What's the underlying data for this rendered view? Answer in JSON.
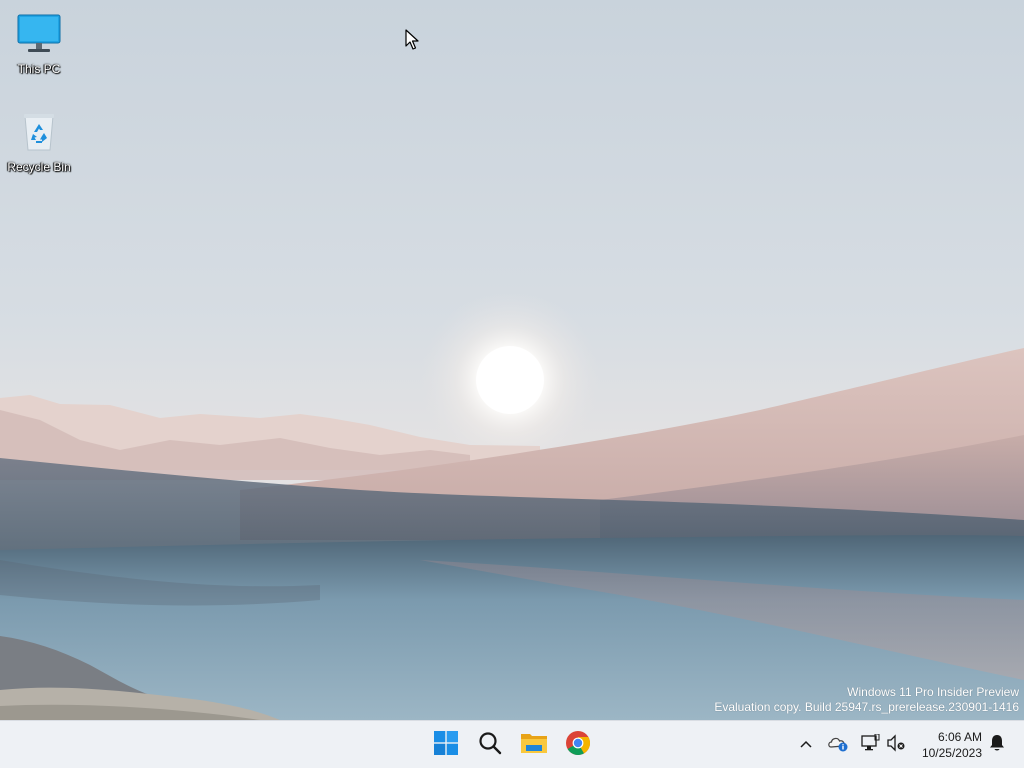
{
  "desktop": {
    "icons": [
      {
        "label": "This PC",
        "icon": "monitor-icon"
      },
      {
        "label": "Recycle Bin",
        "icon": "recycle-bin-icon"
      }
    ],
    "watermark": {
      "line1": "Windows 11 Pro Insider Preview",
      "line2": "Evaluation copy. Build 25947.rs_prerelease.230901-1416"
    }
  },
  "taskbar": {
    "pinned": [
      {
        "name": "Start",
        "icon": "windows-logo-icon"
      },
      {
        "name": "Search",
        "icon": "search-icon"
      },
      {
        "name": "File Explorer",
        "icon": "folder-icon"
      },
      {
        "name": "Google Chrome",
        "icon": "chrome-icon"
      }
    ],
    "tray": {
      "icons": [
        "chevron-up-icon",
        "onedrive-icon",
        "network-icon",
        "volume-muted-icon",
        "notification-bell-icon"
      ],
      "time": "6:06 AM",
      "date": "10/25/2023"
    },
    "colors": {
      "background": "#eef1f5",
      "accent": "#0078d4"
    }
  }
}
